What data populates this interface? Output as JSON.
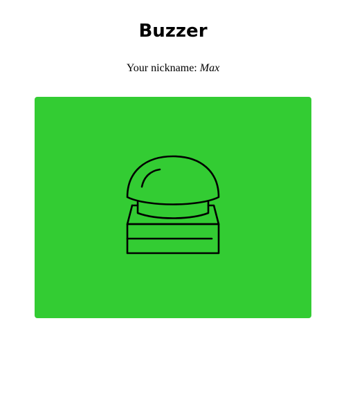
{
  "page": {
    "title": "Buzzer",
    "nickname_label": "Your nickname:",
    "nickname_value": "Max"
  },
  "buzzer": {
    "icon": "buzzer-icon",
    "background_color": "#33cc33",
    "icon_color": "#000000"
  }
}
